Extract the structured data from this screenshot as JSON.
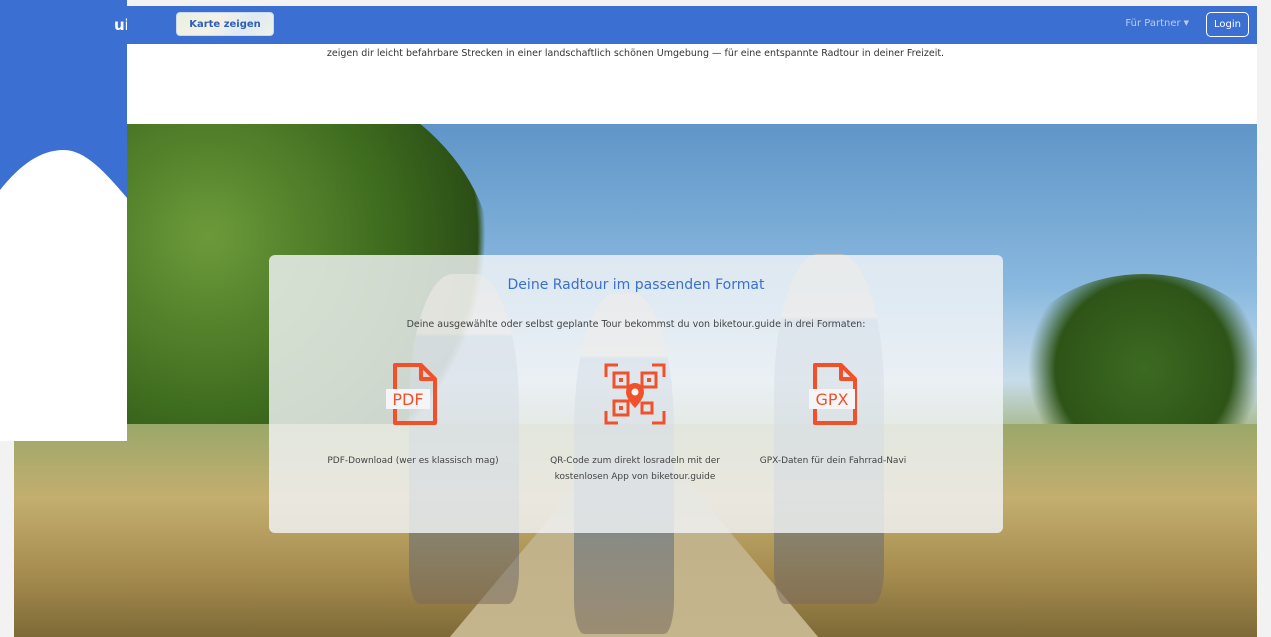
{
  "navbar": {
    "brand": "uide",
    "map_button": "Karte zeigen",
    "partner_menu": "Für Partner",
    "login": "Login"
  },
  "intro_text": "zeigen dir leicht befahrbare Strecken in einer landschaftlich schönen Umgebung — für eine entspannte Radtour in deiner Freizeit.",
  "panel": {
    "title": "Deine Radtour im passenden Format",
    "subtitle": "Deine ausgewählte oder selbst geplante Tour bekommst du von biketour.guide in drei Formaten:",
    "formats": [
      {
        "icon": "pdf-icon",
        "icon_label": "PDF",
        "caption": "PDF-Download (wer es klassisch mag)"
      },
      {
        "icon": "qr-code-icon",
        "icon_label": "",
        "caption_line1": "QR-Code zum direkt losradeln mit der",
        "caption_line2": "kostenlosen App von biketour.guide"
      },
      {
        "icon": "gpx-icon",
        "icon_label": "GPX",
        "caption": "GPX-Daten für dein Fahrrad-Navi"
      }
    ]
  },
  "colors": {
    "brand_blue": "#3b6fd1",
    "icon_orange": "#f0512b"
  }
}
